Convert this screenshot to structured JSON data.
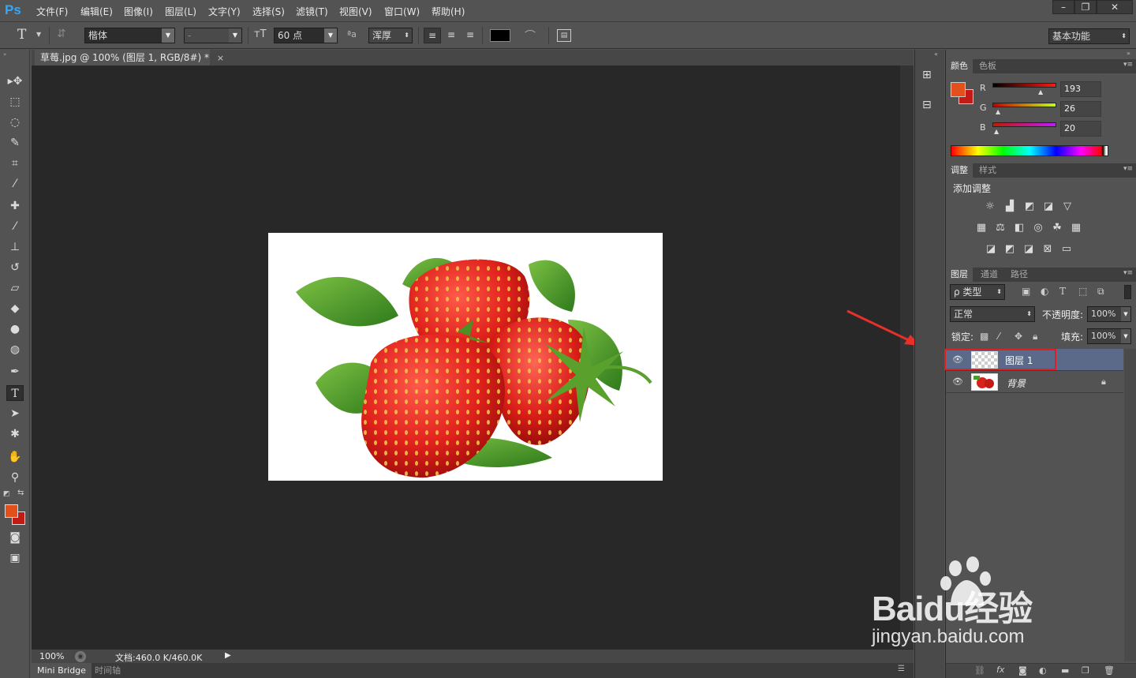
{
  "app": {
    "logo": "Ps",
    "accent_color": "#31a8ff"
  },
  "menubar": {
    "items": [
      "文件(F)",
      "编辑(E)",
      "图像(I)",
      "图层(L)",
      "文字(Y)",
      "选择(S)",
      "滤镜(T)",
      "视图(V)",
      "窗口(W)",
      "帮助(H)"
    ],
    "window_buttons": [
      "–",
      "❐",
      "✕"
    ]
  },
  "options": {
    "tool_icon": "T",
    "font_family": "楷体",
    "font_style": "-",
    "font_size": "60 点",
    "aa_label": "ªa",
    "antialias": "浑厚",
    "text_color": "#000000",
    "workspace": "基本功能"
  },
  "document": {
    "tab_title": "草莓.jpg @ 100% (图层 1, RGB/8#) *",
    "close": "×",
    "zoom": "100%",
    "doc_size": "文档:460.0 K/460.0K"
  },
  "bottom_tabs": [
    "Mini Bridge",
    "时间轴"
  ],
  "color_panel": {
    "tabs": [
      "颜色",
      "色板"
    ],
    "foreground": "#e3501c",
    "background": "#c21a14",
    "channels": [
      {
        "label": "R",
        "value": "193",
        "gradient": "linear-gradient(90deg,#000,#ff1a14)",
        "frac": 0.76
      },
      {
        "label": "G",
        "value": "26",
        "gradient": "linear-gradient(90deg,#c10000,#c1ff14)",
        "frac": 0.1
      },
      {
        "label": "B",
        "value": "20",
        "gradient": "linear-gradient(90deg,#c11a00,#c11aff)",
        "frac": 0.08
      }
    ]
  },
  "adjust_panel": {
    "tabs": [
      "调整",
      "样式"
    ],
    "heading": "添加调整",
    "row1": [
      "brightness-icon",
      "levels-icon",
      "curves-icon",
      "exposure-icon",
      "vibrance-icon"
    ],
    "row2": [
      "hue-saturation-icon",
      "color-balance-icon",
      "black-white-icon",
      "photo-filter-icon",
      "channel-mixer-icon",
      "color-lookup-icon"
    ],
    "row3": [
      "invert-icon",
      "posterize-icon",
      "threshold-icon",
      "selective-color-icon",
      "gradient-map-icon"
    ]
  },
  "layers_panel": {
    "tabs": [
      "图层",
      "通道",
      "路径"
    ],
    "filter": "ρ 类型",
    "blend_mode": "正常",
    "opacity_label": "不透明度:",
    "opacity": "100%",
    "lock_label": "锁定:",
    "fill_label": "填充:",
    "fill": "100%",
    "layers": [
      {
        "name": "图层 1",
        "selected": true,
        "highlight_color": "#e02020"
      },
      {
        "name": "背景",
        "selected": false,
        "locked": true
      }
    ]
  },
  "annotation": {
    "arrow_color": "#e83028"
  },
  "watermark": {
    "brand": "Baidu经验",
    "url": "jingyan.baidu.com"
  }
}
